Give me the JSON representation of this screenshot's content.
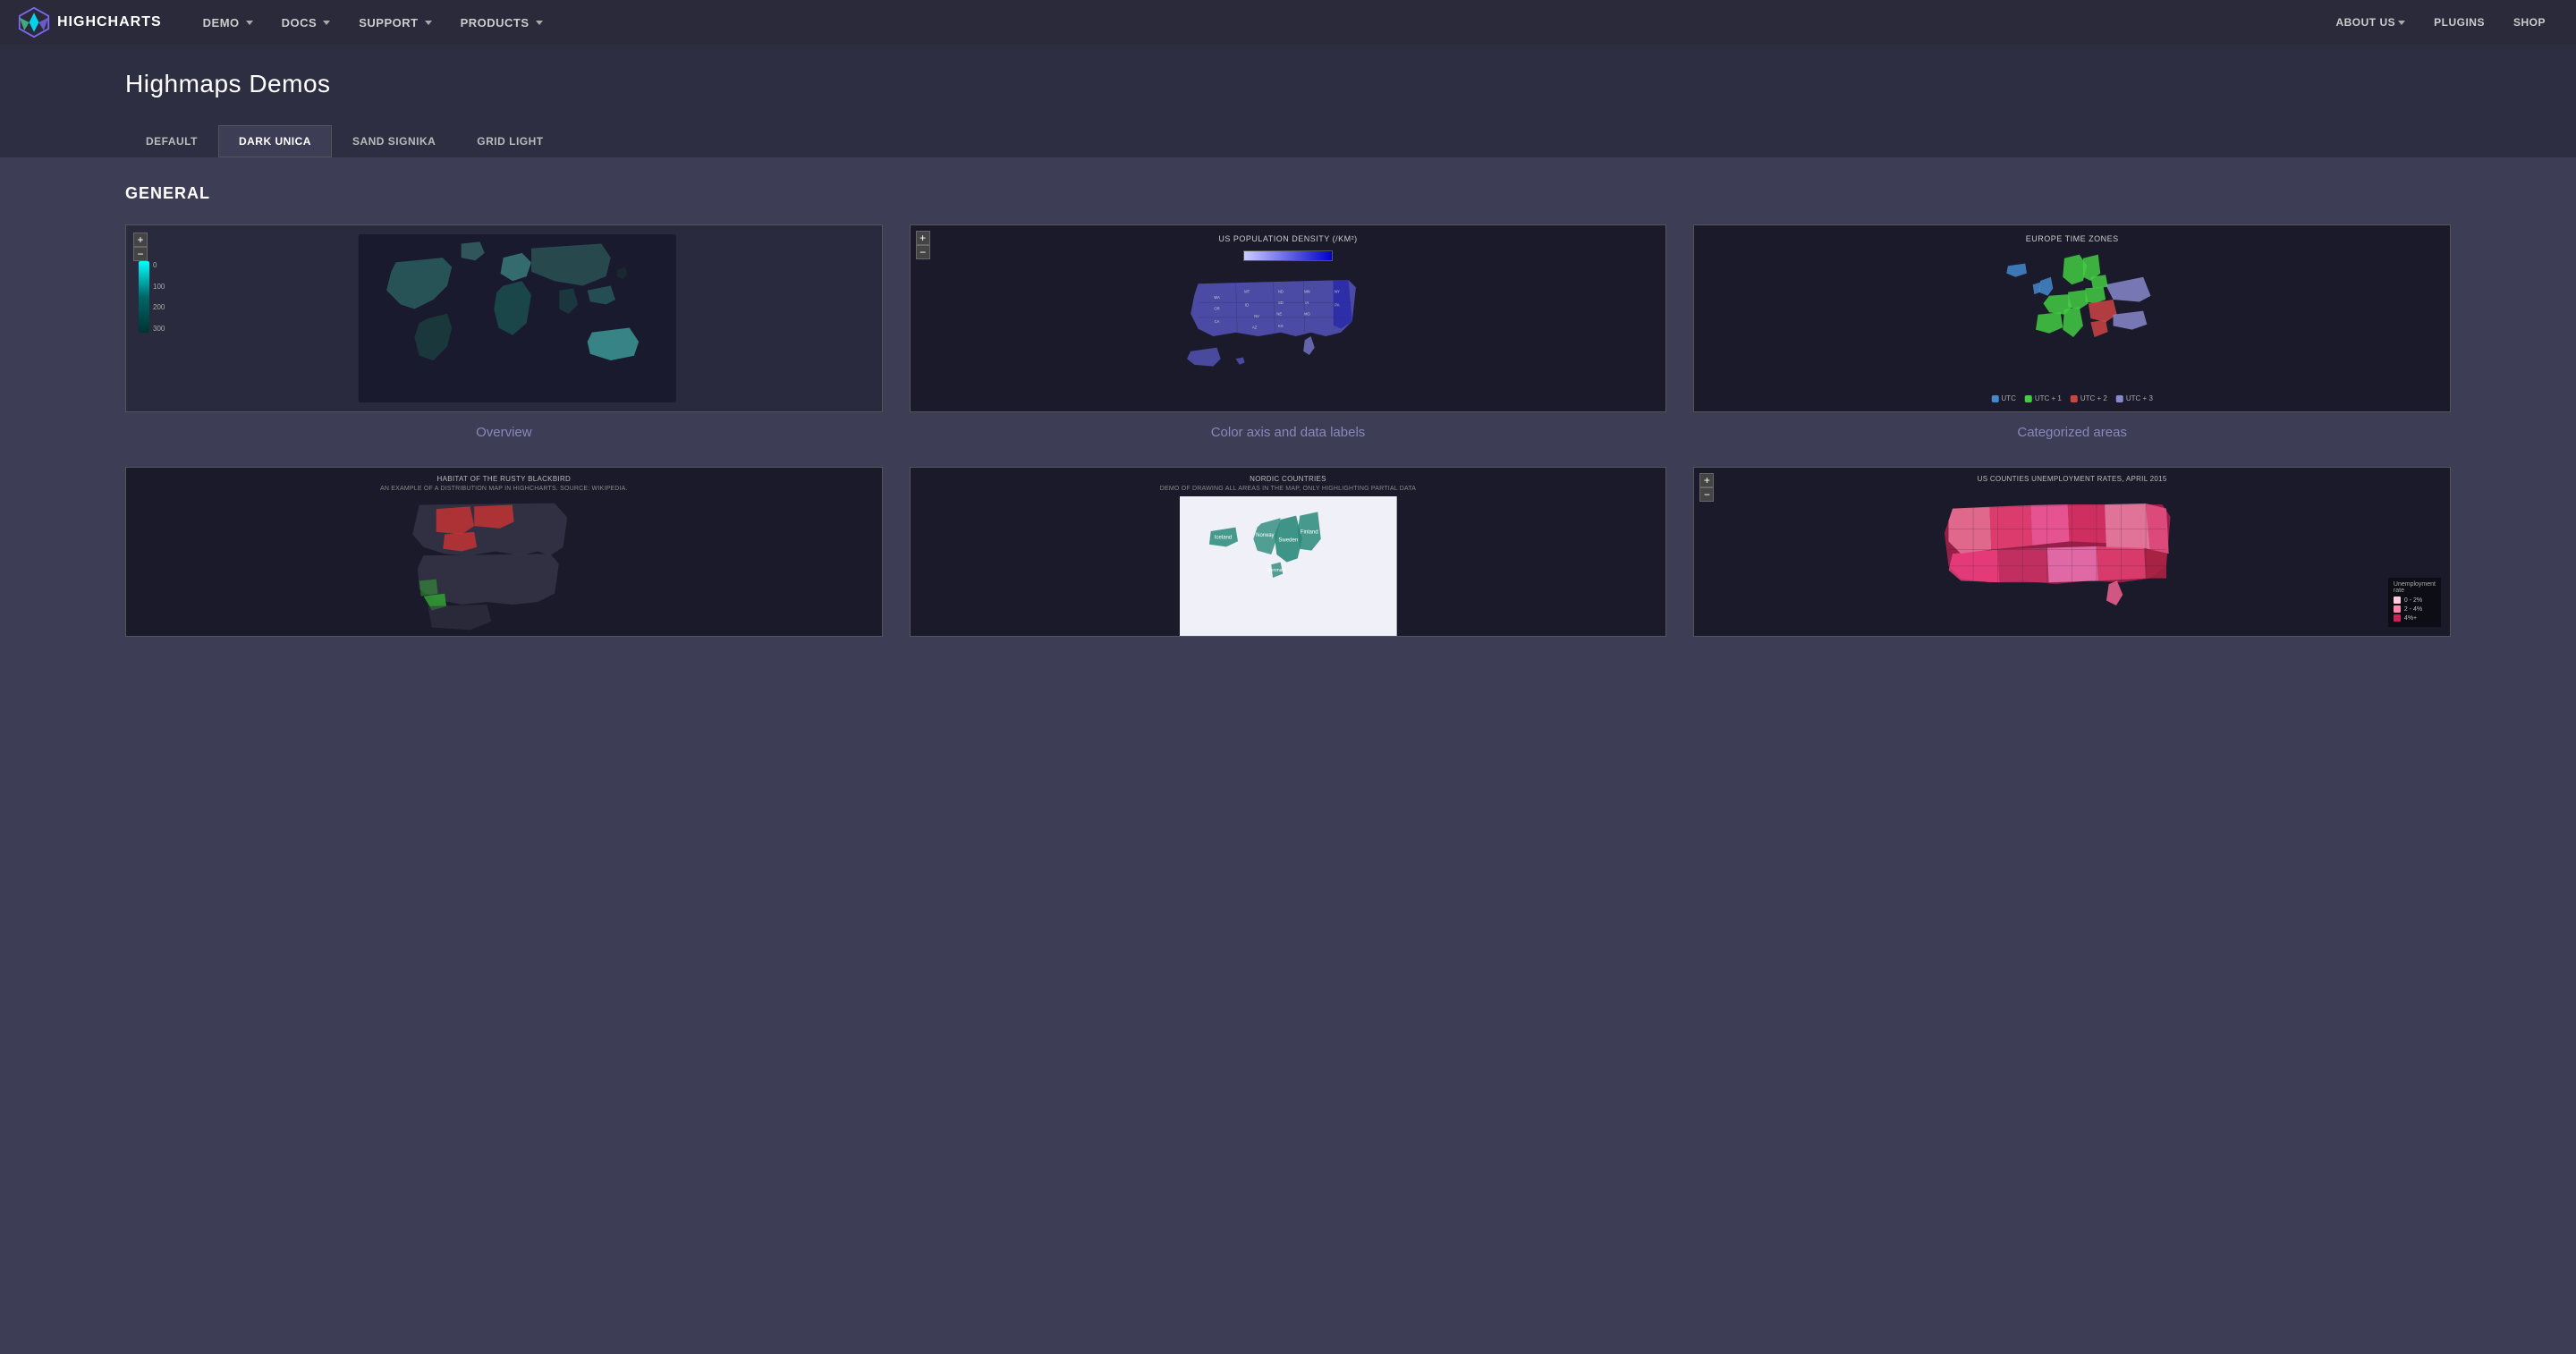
{
  "nav": {
    "logo_text": "HIGHCHARTS",
    "links": [
      {
        "label": "DEMO",
        "has_dropdown": true
      },
      {
        "label": "DOCS",
        "has_dropdown": true
      },
      {
        "label": "SUPPORT",
        "has_dropdown": true
      },
      {
        "label": "PRODUCTS",
        "has_dropdown": true
      }
    ],
    "right_links": [
      {
        "label": "ABOUT US",
        "has_dropdown": true
      },
      {
        "label": "PLUGINS"
      },
      {
        "label": "SHOP"
      }
    ]
  },
  "page": {
    "title": "Highmaps Demos",
    "tabs": [
      {
        "label": "DEFAULT",
        "active": false
      },
      {
        "label": "DARK UNICA",
        "active": true
      },
      {
        "label": "SAND SIGNIKA",
        "active": false
      },
      {
        "label": "GRID LIGHT",
        "active": false
      }
    ]
  },
  "sections": [
    {
      "title": "GENERAL",
      "demos": [
        {
          "label": "Overview",
          "type": "world-map",
          "title": ""
        },
        {
          "label": "Color axis and data labels",
          "type": "us-population",
          "title": "US POPULATION DENSITY (/KM²)"
        },
        {
          "label": "Categorized areas",
          "type": "europe-zones",
          "title": "EUROPE TIME ZONES"
        },
        {
          "label": "",
          "type": "blackbird",
          "title": "HABITAT OF THE RUSTY BLACKBIRD",
          "subtitle": "AN EXAMPLE OF A DISTRIBUTION MAP IN HIGHCHARTS. SOURCE: WIKIPEDIA."
        },
        {
          "label": "",
          "type": "nordic",
          "title": "NORDIC COUNTRIES",
          "subtitle": "DEMO OF DRAWING ALL AREAS IN THE MAP, ONLY HIGHLIGHTING PARTIAL DATA"
        },
        {
          "label": "",
          "type": "unemployment",
          "title": "US COUNTIES UNEMPLOYMENT RATES, APRIL 2015"
        }
      ]
    }
  ],
  "europe_legend": [
    {
      "label": "UTC",
      "color": "#4488cc"
    },
    {
      "label": "UTC + 1",
      "color": "#44cc44"
    },
    {
      "label": "UTC + 2",
      "color": "#cc4444"
    },
    {
      "label": "UTC + 3",
      "color": "#8888cc"
    }
  ],
  "unemployment_legend": [
    {
      "label": "0 - 2%",
      "color": "#ffccdd"
    },
    {
      "label": "2 - 4%",
      "color": "#ff88aa"
    },
    {
      "label": "4%+",
      "color": "#cc2255"
    }
  ]
}
